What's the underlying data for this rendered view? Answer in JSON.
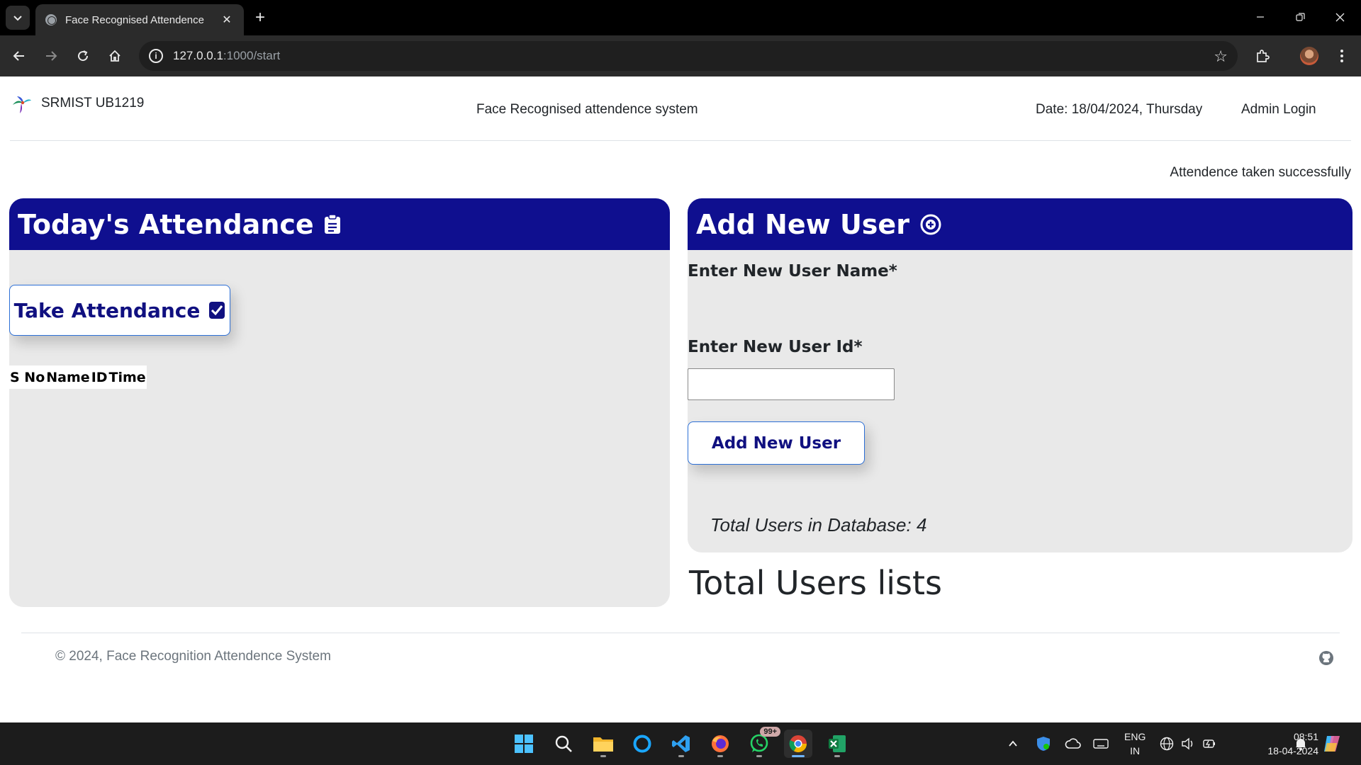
{
  "browser": {
    "tab_title": "Face Recognised Attendence",
    "url_host": "127.0.0.1",
    "url_path": ":1000/start"
  },
  "header": {
    "brand": "SRMIST UB1219",
    "center_title": "Face Recognised attendence system",
    "date": "Date: 18/04/2024, Thursday",
    "admin_login": "Admin Login"
  },
  "flash_message": "Attendence taken successfully",
  "attendance": {
    "heading": "Today's Attendance",
    "take_button": "Take Attendance",
    "columns": [
      "S No",
      "Name",
      "ID",
      "Time"
    ]
  },
  "add_user": {
    "heading": "Add New User",
    "name_label": "Enter New User Name*",
    "id_label": "Enter New User Id*",
    "name_value": "",
    "id_value": "",
    "button": "Add New User",
    "total": "Total Users in Database: 4"
  },
  "users_list_title": "Total Users lists",
  "footer": {
    "text": "© 2024, Face Recognition Attendence System"
  },
  "taskbar": {
    "whatsapp_badge": "99+",
    "lang_line1": "ENG",
    "lang_line2": "IN",
    "time": "08:51",
    "date": "18-04-2024"
  },
  "colors": {
    "card_header": "#0f0f8f",
    "card_body": "#e9e9e9",
    "button_text": "#101080",
    "button_border": "#2c6fd6"
  }
}
